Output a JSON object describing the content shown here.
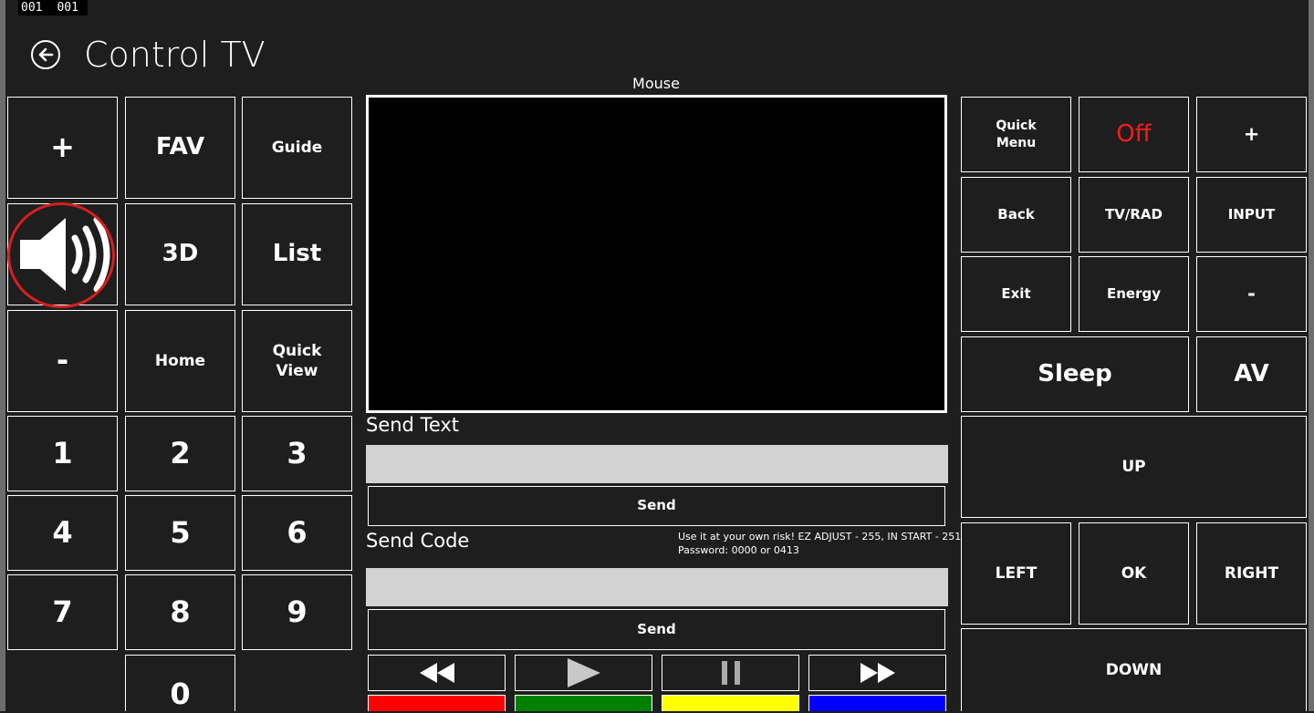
{
  "counter": {
    "a": "001",
    "b": "001"
  },
  "header": {
    "title": "Control TV"
  },
  "left_pad": {
    "vol_up": "+",
    "fav": "FAV",
    "guide": "Guide",
    "three_d": "3D",
    "list": "List",
    "vol_down": "-",
    "home": "Home",
    "quick_view_line1": "Quick",
    "quick_view_line2": "View",
    "digits": [
      "1",
      "2",
      "3",
      "4",
      "5",
      "6",
      "7",
      "8",
      "9",
      "0"
    ]
  },
  "center": {
    "mouse_label": "Mouse",
    "send_text_label": "Send Text",
    "send_text_value": "",
    "send_text_button": "Send",
    "send_code_label": "Send Code",
    "send_code_value": "",
    "send_code_button": "Send",
    "warning_line1": "Use it at your own risk! EZ ADJUST - 255, IN START - 251",
    "warning_line2": "Password: 0000 or 0413"
  },
  "media": {
    "buttons": [
      "rewind-icon",
      "play-icon",
      "pause-icon",
      "fast-forward-icon"
    ]
  },
  "color_keys": {
    "red": "#ff0000",
    "green": "#008000",
    "yellow": "#ffff00",
    "blue": "#0000ff"
  },
  "right_pad": {
    "quick_menu_line1": "Quick",
    "quick_menu_line2": "Menu",
    "off": "Off",
    "ch_up": "+",
    "back": "Back",
    "tv_rad": "TV/RAD",
    "input": "INPUT",
    "exit": "Exit",
    "energy": "Energy",
    "ch_down": "-",
    "sleep": "Sleep",
    "av": "AV",
    "up": "UP",
    "left": "LEFT",
    "ok": "OK",
    "right": "RIGHT",
    "down": "DOWN"
  },
  "colors": {
    "background": "#1e1e1e",
    "off_red": "#ff1a1a",
    "volume_ring": "#d81e1e",
    "input_bg": "#d2d2d2"
  }
}
